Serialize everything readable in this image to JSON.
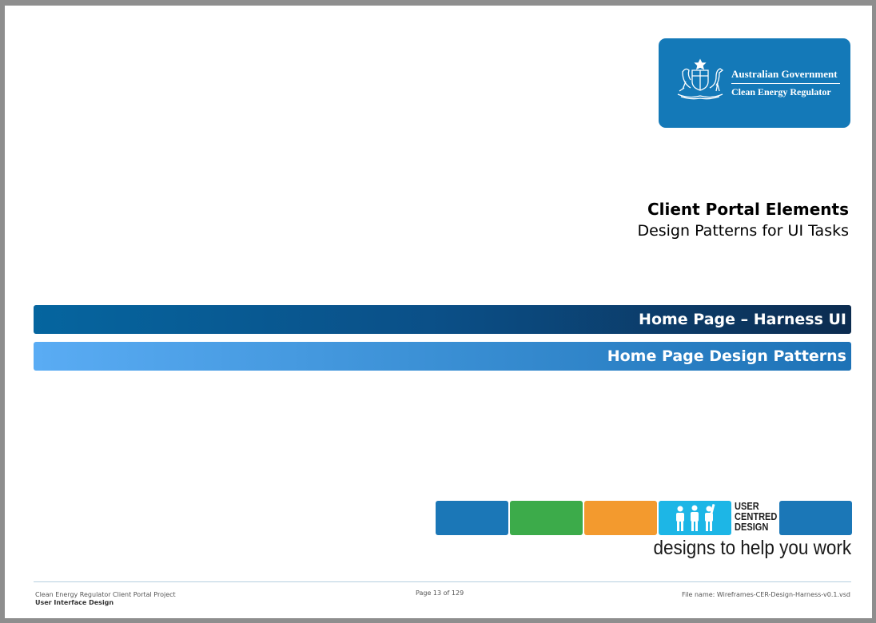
{
  "logo": {
    "line1": "Australian Government",
    "line2": "Clean Energy Regulator",
    "bg_color": "#1479b8"
  },
  "document": {
    "title": "Client Portal Elements",
    "subtitle": "Design Patterns for UI Tasks"
  },
  "banners": [
    {
      "label": "Home Page – Harness UI",
      "color": "#0b4f87"
    },
    {
      "label": "Home Page Design Patterns",
      "color": "#3a8fd4"
    }
  ],
  "ucd": {
    "line1": "USER",
    "line2": "CENTRED",
    "line3": "DESIGN",
    "tagline": "designs to help you work",
    "colors": [
      "#1b77b7",
      "#3cab4a",
      "#f39a2e",
      "#1db6e6",
      "#1b77b7"
    ]
  },
  "footer": {
    "project": "Clean Energy Regulator Client Portal Project",
    "section": "User Interface Design",
    "page": "Page 13 of 129",
    "filename": "File name: Wireframes-CER-Design-Harness-v0.1.vsd"
  }
}
